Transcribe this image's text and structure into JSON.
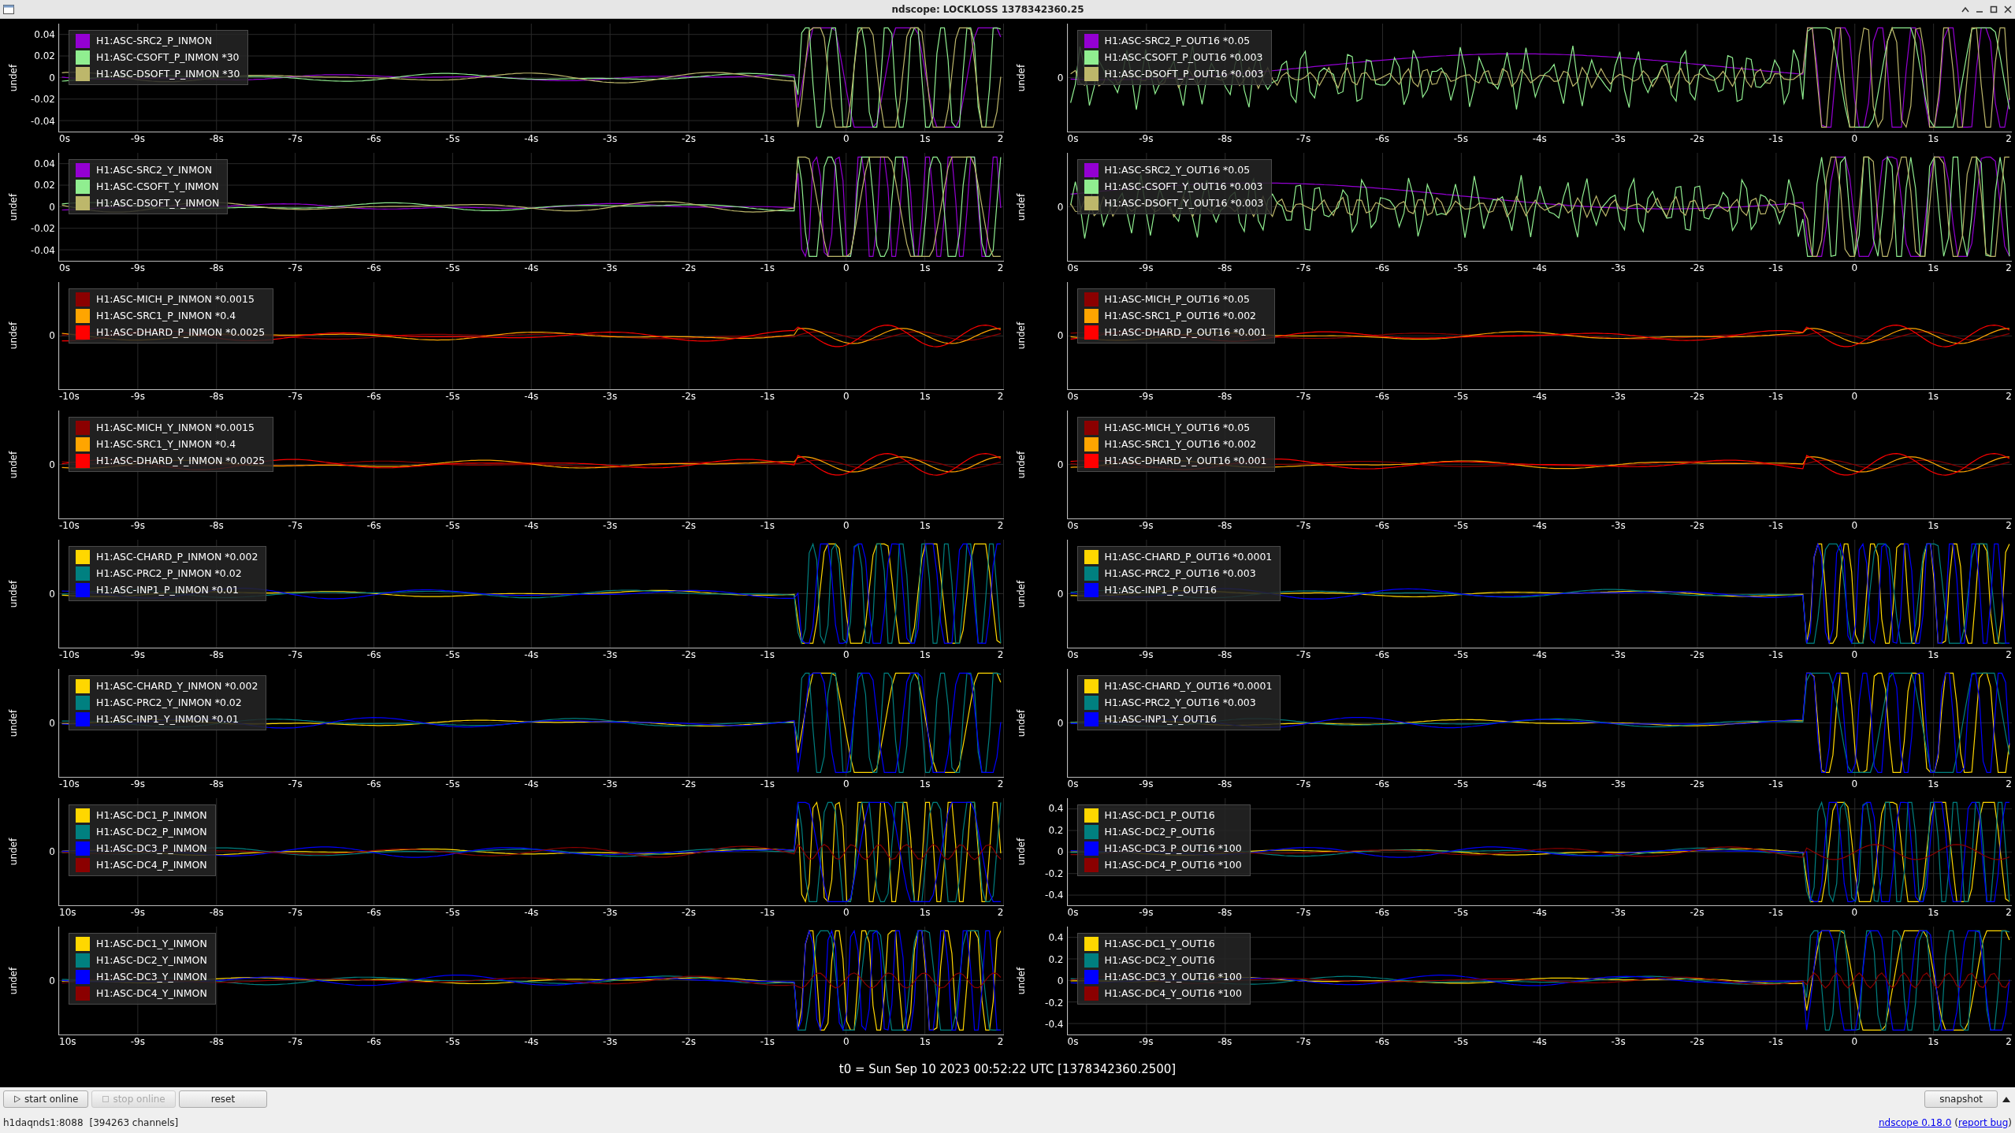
{
  "window": {
    "title": "ndscope: LOCKLOSS 1378342360.25"
  },
  "plots": [
    {
      "ylabel": "undef",
      "yticks": [
        "0.04",
        "0.02",
        "0",
        "-0.02",
        "-0.04"
      ],
      "xticks": [
        "0s",
        "-9s",
        "-8s",
        "-7s",
        "-6s",
        "-5s",
        "-4s",
        "-3s",
        "-2s",
        "-1s",
        "0",
        "1s",
        "2"
      ],
      "legend": [
        {
          "label": "H1:ASC-SRC2_P_INMON",
          "color": "#9400d3"
        },
        {
          "label": "H1:ASC-CSOFT_P_INMON *30",
          "color": "#90ee90"
        },
        {
          "label": "H1:ASC-DSOFT_P_INMON *30",
          "color": "#bdb76b"
        }
      ]
    },
    {
      "ylabel": "undef",
      "yticks": [
        "0"
      ],
      "xticks": [
        "0s",
        "-9s",
        "-8s",
        "-7s",
        "-6s",
        "-5s",
        "-4s",
        "-3s",
        "-2s",
        "-1s",
        "0",
        "1s",
        "2"
      ],
      "legend": [
        {
          "label": "H1:ASC-SRC2_P_OUT16 *0.05",
          "color": "#9400d3"
        },
        {
          "label": "H1:ASC-CSOFT_P_OUT16 *0.003",
          "color": "#90ee90"
        },
        {
          "label": "H1:ASC-DSOFT_P_OUT16 *0.003",
          "color": "#bdb76b"
        }
      ]
    },
    {
      "ylabel": "undef",
      "yticks": [
        "0.04",
        "0.02",
        "0",
        "-0.02",
        "-0.04"
      ],
      "xticks": [
        "0s",
        "-9s",
        "-8s",
        "-7s",
        "-6s",
        "-5s",
        "-4s",
        "-3s",
        "-2s",
        "-1s",
        "0",
        "1s",
        "2"
      ],
      "legend": [
        {
          "label": "H1:ASC-SRC2_Y_INMON",
          "color": "#9400d3"
        },
        {
          "label": "H1:ASC-CSOFT_Y_INMON",
          "color": "#90ee90"
        },
        {
          "label": "H1:ASC-DSOFT_Y_INMON",
          "color": "#bdb76b"
        }
      ]
    },
    {
      "ylabel": "undef",
      "yticks": [
        "0"
      ],
      "xticks": [
        "0s",
        "-9s",
        "-8s",
        "-7s",
        "-6s",
        "-5s",
        "-4s",
        "-3s",
        "-2s",
        "-1s",
        "0",
        "1s",
        "2"
      ],
      "legend": [
        {
          "label": "H1:ASC-SRC2_Y_OUT16 *0.05",
          "color": "#9400d3"
        },
        {
          "label": "H1:ASC-CSOFT_Y_OUT16 *0.003",
          "color": "#90ee90"
        },
        {
          "label": "H1:ASC-DSOFT_Y_OUT16 *0.003",
          "color": "#bdb76b"
        }
      ]
    },
    {
      "ylabel": "undef",
      "yticks": [
        "0"
      ],
      "xticks": [
        "-10s",
        "-9s",
        "-8s",
        "-7s",
        "-6s",
        "-5s",
        "-4s",
        "-3s",
        "-2s",
        "-1s",
        "0",
        "1s",
        "2"
      ],
      "legend": [
        {
          "label": "H1:ASC-MICH_P_INMON *0.0015",
          "color": "#8b0000"
        },
        {
          "label": "H1:ASC-SRC1_P_INMON *0.4",
          "color": "#ffa500"
        },
        {
          "label": "H1:ASC-DHARD_P_INMON *0.0025",
          "color": "#ff0000"
        }
      ]
    },
    {
      "ylabel": "undef",
      "yticks": [
        "0"
      ],
      "xticks": [
        "0s",
        "-9s",
        "-8s",
        "-7s",
        "-6s",
        "-5s",
        "-4s",
        "-3s",
        "-2s",
        "-1s",
        "0",
        "1s",
        "2"
      ],
      "legend": [
        {
          "label": "H1:ASC-MICH_P_OUT16 *0.05",
          "color": "#8b0000"
        },
        {
          "label": "H1:ASC-SRC1_P_OUT16 *0.002",
          "color": "#ffa500"
        },
        {
          "label": "H1:ASC-DHARD_P_OUT16 *0.001",
          "color": "#ff0000"
        }
      ]
    },
    {
      "ylabel": "undef",
      "yticks": [
        "0"
      ],
      "xticks": [
        "-10s",
        "-9s",
        "-8s",
        "-7s",
        "-6s",
        "-5s",
        "-4s",
        "-3s",
        "-2s",
        "-1s",
        "0",
        "1s",
        "2"
      ],
      "legend": [
        {
          "label": "H1:ASC-MICH_Y_INMON *0.0015",
          "color": "#8b0000"
        },
        {
          "label": "H1:ASC-SRC1_Y_INMON *0.4",
          "color": "#ffa500"
        },
        {
          "label": "H1:ASC-DHARD_Y_INMON *0.0025",
          "color": "#ff0000"
        }
      ]
    },
    {
      "ylabel": "undef",
      "yticks": [
        "0"
      ],
      "xticks": [
        "0s",
        "-9s",
        "-8s",
        "-7s",
        "-6s",
        "-5s",
        "-4s",
        "-3s",
        "-2s",
        "-1s",
        "0",
        "1s",
        "2"
      ],
      "legend": [
        {
          "label": "H1:ASC-MICH_Y_OUT16 *0.05",
          "color": "#8b0000"
        },
        {
          "label": "H1:ASC-SRC1_Y_OUT16 *0.002",
          "color": "#ffa500"
        },
        {
          "label": "H1:ASC-DHARD_Y_OUT16 *0.001",
          "color": "#ff0000"
        }
      ]
    },
    {
      "ylabel": "undef",
      "yticks": [
        "0"
      ],
      "xticks": [
        "-10s",
        "-9s",
        "-8s",
        "-7s",
        "-6s",
        "-5s",
        "-4s",
        "-3s",
        "-2s",
        "-1s",
        "0",
        "1s",
        "2"
      ],
      "legend": [
        {
          "label": "H1:ASC-CHARD_P_INMON *0.002",
          "color": "#ffd700"
        },
        {
          "label": "H1:ASC-PRC2_P_INMON *0.02",
          "color": "#008080"
        },
        {
          "label": "H1:ASC-INP1_P_INMON *0.01",
          "color": "#0000ff"
        }
      ]
    },
    {
      "ylabel": "undef",
      "yticks": [
        "0"
      ],
      "xticks": [
        "0s",
        "-9s",
        "-8s",
        "-7s",
        "-6s",
        "-5s",
        "-4s",
        "-3s",
        "-2s",
        "-1s",
        "0",
        "1s",
        "2"
      ],
      "legend": [
        {
          "label": "H1:ASC-CHARD_P_OUT16 *0.0001",
          "color": "#ffd700"
        },
        {
          "label": "H1:ASC-PRC2_P_OUT16 *0.003",
          "color": "#008080"
        },
        {
          "label": "H1:ASC-INP1_P_OUT16",
          "color": "#0000ff"
        }
      ]
    },
    {
      "ylabel": "undef",
      "yticks": [
        "0"
      ],
      "xticks": [
        "-10s",
        "-9s",
        "-8s",
        "-7s",
        "-6s",
        "-5s",
        "-4s",
        "-3s",
        "-2s",
        "-1s",
        "0",
        "1s",
        "2"
      ],
      "legend": [
        {
          "label": "H1:ASC-CHARD_Y_INMON *0.002",
          "color": "#ffd700"
        },
        {
          "label": "H1:ASC-PRC2_Y_INMON *0.02",
          "color": "#008080"
        },
        {
          "label": "H1:ASC-INP1_Y_INMON *0.01",
          "color": "#0000ff"
        }
      ]
    },
    {
      "ylabel": "undef",
      "yticks": [
        "0"
      ],
      "xticks": [
        "0s",
        "-9s",
        "-8s",
        "-7s",
        "-6s",
        "-5s",
        "-4s",
        "-3s",
        "-2s",
        "-1s",
        "0",
        "1s",
        "2"
      ],
      "legend": [
        {
          "label": "H1:ASC-CHARD_Y_OUT16 *0.0001",
          "color": "#ffd700"
        },
        {
          "label": "H1:ASC-PRC2_Y_OUT16 *0.003",
          "color": "#008080"
        },
        {
          "label": "H1:ASC-INP1_Y_OUT16",
          "color": "#0000ff"
        }
      ]
    },
    {
      "ylabel": "undef",
      "yticks": [
        "0"
      ],
      "xticks": [
        "10s",
        "-9s",
        "-8s",
        "-7s",
        "-6s",
        "-5s",
        "-4s",
        "-3s",
        "-2s",
        "-1s",
        "0",
        "1s",
        "2"
      ],
      "legend": [
        {
          "label": "H1:ASC-DC1_P_INMON",
          "color": "#ffd700"
        },
        {
          "label": "H1:ASC-DC2_P_INMON",
          "color": "#008080"
        },
        {
          "label": "H1:ASC-DC3_P_INMON",
          "color": "#0000ff"
        },
        {
          "label": "H1:ASC-DC4_P_INMON",
          "color": "#8b0000"
        }
      ]
    },
    {
      "ylabel": "undef",
      "yticks": [
        "0.4",
        "0.2",
        "0",
        "-0.2",
        "-0.4"
      ],
      "xticks": [
        "0s",
        "-9s",
        "-8s",
        "-7s",
        "-6s",
        "-5s",
        "-4s",
        "-3s",
        "-2s",
        "-1s",
        "0",
        "1s",
        "2"
      ],
      "legend": [
        {
          "label": "H1:ASC-DC1_P_OUT16",
          "color": "#ffd700"
        },
        {
          "label": "H1:ASC-DC2_P_OUT16",
          "color": "#008080"
        },
        {
          "label": "H1:ASC-DC3_P_OUT16 *100",
          "color": "#0000ff"
        },
        {
          "label": "H1:ASC-DC4_P_OUT16 *100",
          "color": "#8b0000"
        }
      ]
    },
    {
      "ylabel": "undef",
      "yticks": [
        "0"
      ],
      "xticks": [
        "10s",
        "-9s",
        "-8s",
        "-7s",
        "-6s",
        "-5s",
        "-4s",
        "-3s",
        "-2s",
        "-1s",
        "0",
        "1s",
        "2"
      ],
      "legend": [
        {
          "label": "H1:ASC-DC1_Y_INMON",
          "color": "#ffd700"
        },
        {
          "label": "H1:ASC-DC2_Y_INMON",
          "color": "#008080"
        },
        {
          "label": "H1:ASC-DC3_Y_INMON",
          "color": "#0000ff"
        },
        {
          "label": "H1:ASC-DC4_Y_INMON",
          "color": "#8b0000"
        }
      ]
    },
    {
      "ylabel": "undef",
      "yticks": [
        "0.4",
        "0.2",
        "0",
        "-0.2",
        "-0.4"
      ],
      "xticks": [
        "0s",
        "-9s",
        "-8s",
        "-7s",
        "-6s",
        "-5s",
        "-4s",
        "-3s",
        "-2s",
        "-1s",
        "0",
        "1s",
        "2"
      ],
      "legend": [
        {
          "label": "H1:ASC-DC1_Y_OUT16",
          "color": "#ffd700"
        },
        {
          "label": "H1:ASC-DC2_Y_OUT16",
          "color": "#008080"
        },
        {
          "label": "H1:ASC-DC3_Y_OUT16 *100",
          "color": "#0000ff"
        },
        {
          "label": "H1:ASC-DC4_Y_OUT16 *100",
          "color": "#8b0000"
        }
      ]
    }
  ],
  "t0_label": "t0 = Sun Sep 10 2023 00:52:22 UTC [1378342360.2500]",
  "toolbar": {
    "buttons": [
      {
        "label": "start online",
        "kind": "start",
        "disabled": false
      },
      {
        "label": "stop online",
        "kind": "stop",
        "disabled": true
      },
      {
        "label": "reset",
        "kind": "plain",
        "disabled": false
      }
    ],
    "snapshot": "snapshot"
  },
  "status": {
    "server": "h1daqnds1:8088",
    "channels": "[394263 channels]",
    "version": "ndscope 0.18.0",
    "open_paren": "(",
    "report": "report bug",
    "close_paren": ")"
  }
}
